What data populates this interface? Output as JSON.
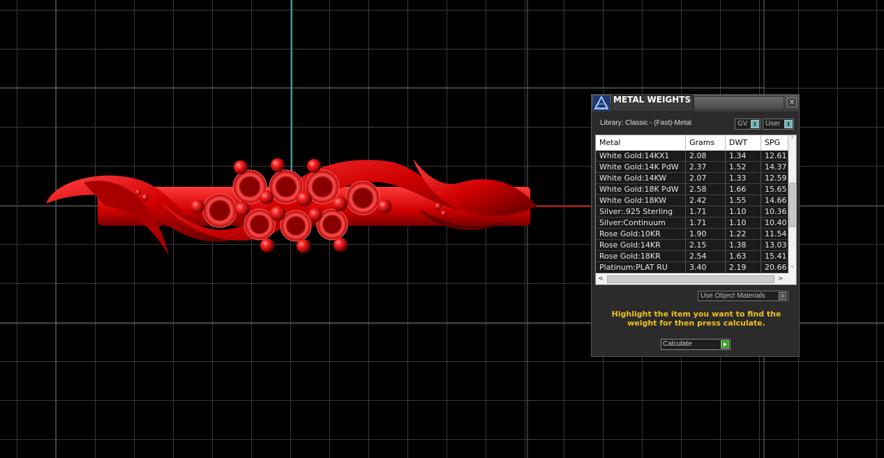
{
  "panel": {
    "title": "METAL WEIGHTS",
    "close_label": "×",
    "library_label": "Library: Classic - (Fast)-Metal",
    "toggle_gv": "GV",
    "toggle_user": "User",
    "use_object_materials": "Use Object Materials",
    "instruction": "Highlight the item you want to find the weight for then press calculate.",
    "calculate_label": "Calculate",
    "scroll_up": "˄",
    "scroll_down": "˅",
    "scroll_left": "<",
    "scroll_right": ">"
  },
  "table": {
    "columns": [
      "Metal",
      "Grams",
      "DWT",
      "SPG"
    ],
    "rows": [
      {
        "metal": "White Gold:14KX1",
        "grams": "2.08",
        "dwt": "1.34",
        "spg": "12.61"
      },
      {
        "metal": "White Gold:14K PdW",
        "grams": "2.37",
        "dwt": "1.52",
        "spg": "14.37"
      },
      {
        "metal": "White Gold:14KW",
        "grams": "2.07",
        "dwt": "1.33",
        "spg": "12.59"
      },
      {
        "metal": "White Gold:18K PdW",
        "grams": "2.58",
        "dwt": "1.66",
        "spg": "15.65"
      },
      {
        "metal": "White Gold:18KW",
        "grams": "2.42",
        "dwt": "1.55",
        "spg": "14.66"
      },
      {
        "metal": "Silver:.925 Sterling",
        "grams": "1.71",
        "dwt": "1.10",
        "spg": "10.36"
      },
      {
        "metal": "Silver:Continuum",
        "grams": "1.71",
        "dwt": "1.10",
        "spg": "10.40"
      },
      {
        "metal": "Rose Gold:10KR",
        "grams": "1.90",
        "dwt": "1.22",
        "spg": "11.54"
      },
      {
        "metal": "Rose Gold:14KR",
        "grams": "2.15",
        "dwt": "1.38",
        "spg": "13.03"
      },
      {
        "metal": "Rose Gold:18KR",
        "grams": "2.54",
        "dwt": "1.63",
        "spg": "15.41"
      },
      {
        "metal": "Platinum:PLAT RU",
        "grams": "3.40",
        "dwt": "2.19",
        "spg": "20.66"
      }
    ]
  },
  "colors": {
    "model_red": "#e01010",
    "highlight_text": "#f0c020",
    "viewport_bg": "#000000",
    "grid_line": "#3a3a3a",
    "axis_cyan": "#3f9bb0"
  },
  "icons": {
    "logo": "app-logo-icon",
    "close": "close-icon",
    "toggle": "toggle-icon",
    "calculate": "play-arrow-icon"
  }
}
